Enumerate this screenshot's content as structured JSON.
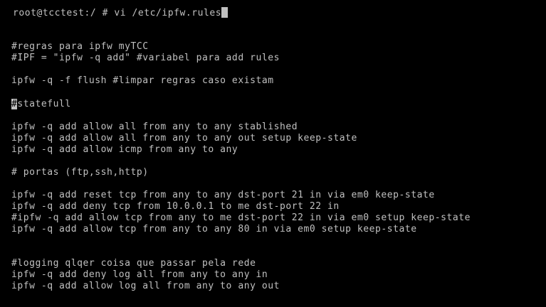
{
  "terminal": {
    "prompt": "root@tcctest:/ # vi /etc/ipfw.rules",
    "cursor_char": "#",
    "lines": [
      "#regras para ipfw myTCC",
      "#IPF = \"ipfw -q add\" #variabel para add rules",
      "ipfw -q -f flush #limpar regras caso existam",
      "statefull",
      "ipfw -q add allow all from any to any stablished",
      "ipfw -q add allow all from any to any out setup keep-state",
      "ipfw -q add allow icmp from any to any",
      "# portas (ftp,ssh,http)",
      "ipfw -q add reset tcp from any to any dst-port 21 in via em0 keep-state",
      "ipfw -q add deny tcp from 10.0.0.1 to me dst-port 22 in",
      "#ipfw -q add allow tcp from any to me dst-port 22 in via em0 setup keep-state",
      "ipfw -q add allow tcp from any to any 80 in via em0 setup keep-state",
      "#logging qlqer coisa que passar pela rede",
      "ipfw -q add deny log all from any to any in",
      "ipfw -q add allow log all from any to any out"
    ]
  }
}
